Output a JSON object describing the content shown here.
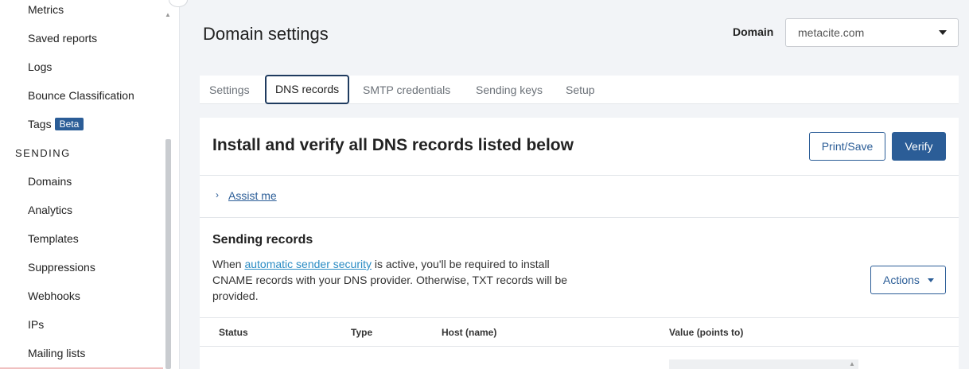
{
  "sidebar": {
    "items_top": [
      {
        "label": "Metrics"
      },
      {
        "label": "Saved reports"
      },
      {
        "label": "Logs"
      },
      {
        "label": "Bounce Classification"
      },
      {
        "label": "Tags",
        "badge": "Beta"
      }
    ],
    "section_heading": "SENDING",
    "items_sending": [
      {
        "label": "Domains"
      },
      {
        "label": "Analytics"
      },
      {
        "label": "Templates"
      },
      {
        "label": "Suppressions"
      },
      {
        "label": "Webhooks"
      },
      {
        "label": "IPs"
      },
      {
        "label": "Mailing lists"
      }
    ]
  },
  "header": {
    "title": "Domain settings",
    "domain_label": "Domain",
    "domain_value": "metacite.com"
  },
  "tabs": [
    {
      "label": "Settings",
      "active": false
    },
    {
      "label": "DNS records",
      "active": true
    },
    {
      "label": "SMTP credentials",
      "active": false
    },
    {
      "label": "Sending keys",
      "active": false
    },
    {
      "label": "Setup",
      "active": false
    }
  ],
  "card": {
    "title": "Install and verify all DNS records listed below",
    "print_label": "Print/Save",
    "verify_label": "Verify",
    "assist_label": "Assist me",
    "sending_title": "Sending records",
    "desc_pre": "When ",
    "desc_link": "automatic sender security",
    "desc_post": " is active, you'll be required to install CNAME records with your DNS provider. Otherwise, TXT records will be provided.",
    "actions_label": "Actions"
  },
  "table": {
    "columns": [
      "Status",
      "Type",
      "Host (name)",
      "Value (points to)"
    ]
  },
  "colors": {
    "accent": "#2b5d97",
    "link": "#2b8cc4",
    "background": "#f2f4f7"
  }
}
